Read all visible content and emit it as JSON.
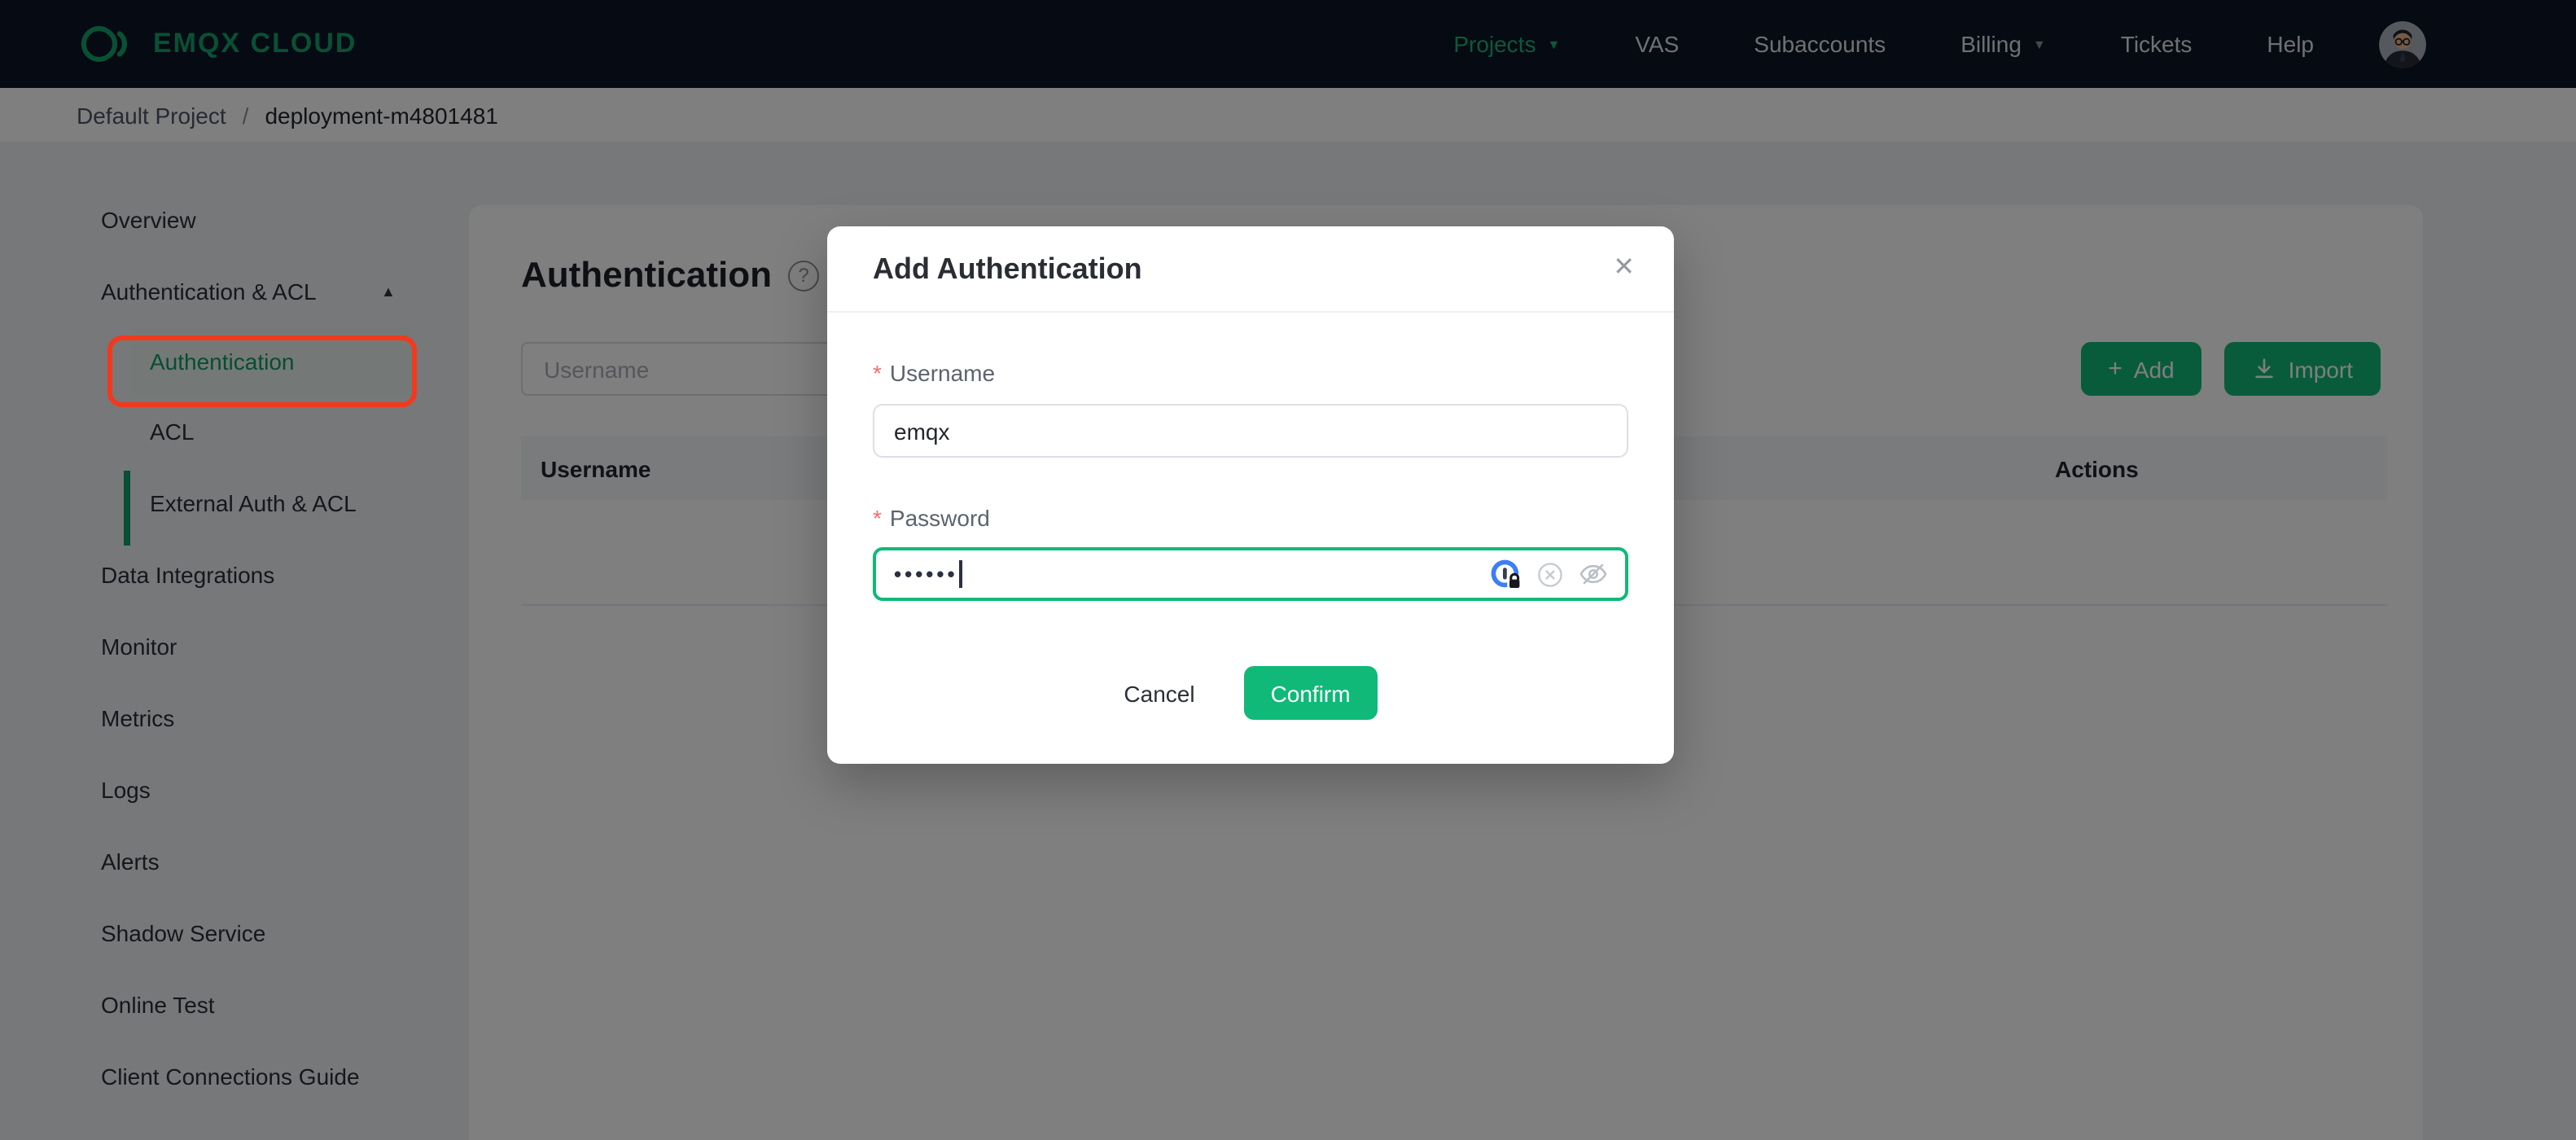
{
  "navbar": {
    "brand": "EMQX CLOUD",
    "links": [
      {
        "label": "Projects",
        "caret": "▼",
        "active": true
      },
      {
        "label": "VAS"
      },
      {
        "label": "Subaccounts"
      },
      {
        "label": "Billing",
        "caret": "▼"
      },
      {
        "label": "Tickets"
      },
      {
        "label": "Help"
      }
    ]
  },
  "breadcrumb": {
    "project": "Default Project",
    "separator": "/",
    "deployment": "deployment-m4801481"
  },
  "sidebar": {
    "items_top": [
      "Overview"
    ],
    "group": {
      "label": "Authentication & ACL",
      "caret": "▲",
      "children": [
        "Authentication",
        "ACL",
        "External Auth & ACL"
      ],
      "active_child": "Authentication"
    },
    "items_bottom": [
      "Data Integrations",
      "Monitor",
      "Metrics",
      "Logs",
      "Alerts",
      "Shadow Service",
      "Online Test",
      "Client Connections Guide"
    ]
  },
  "main": {
    "title": "Authentication",
    "help_glyph": "?",
    "search_placeholder": "Username",
    "add_glyph": "+",
    "add_label": "Add",
    "import_label": "Import",
    "table": {
      "columns": [
        "Username",
        "Actions"
      ]
    }
  },
  "modal": {
    "title": "Add Authentication",
    "close_glyph": "✕",
    "required_marker": "*",
    "username": {
      "label": "Username",
      "value": "emqx"
    },
    "password": {
      "label": "Password",
      "value": "••••••",
      "masked": true
    },
    "cancel_label": "Cancel",
    "confirm_label": "Confirm"
  },
  "colors": {
    "accent_green": "#10b978",
    "navbar_bg": "#0d1424",
    "annotation_red": "#f2391c",
    "onepassword_blue": "#3d7ef5",
    "overlay": "rgba(0,0,0,0.5)"
  }
}
